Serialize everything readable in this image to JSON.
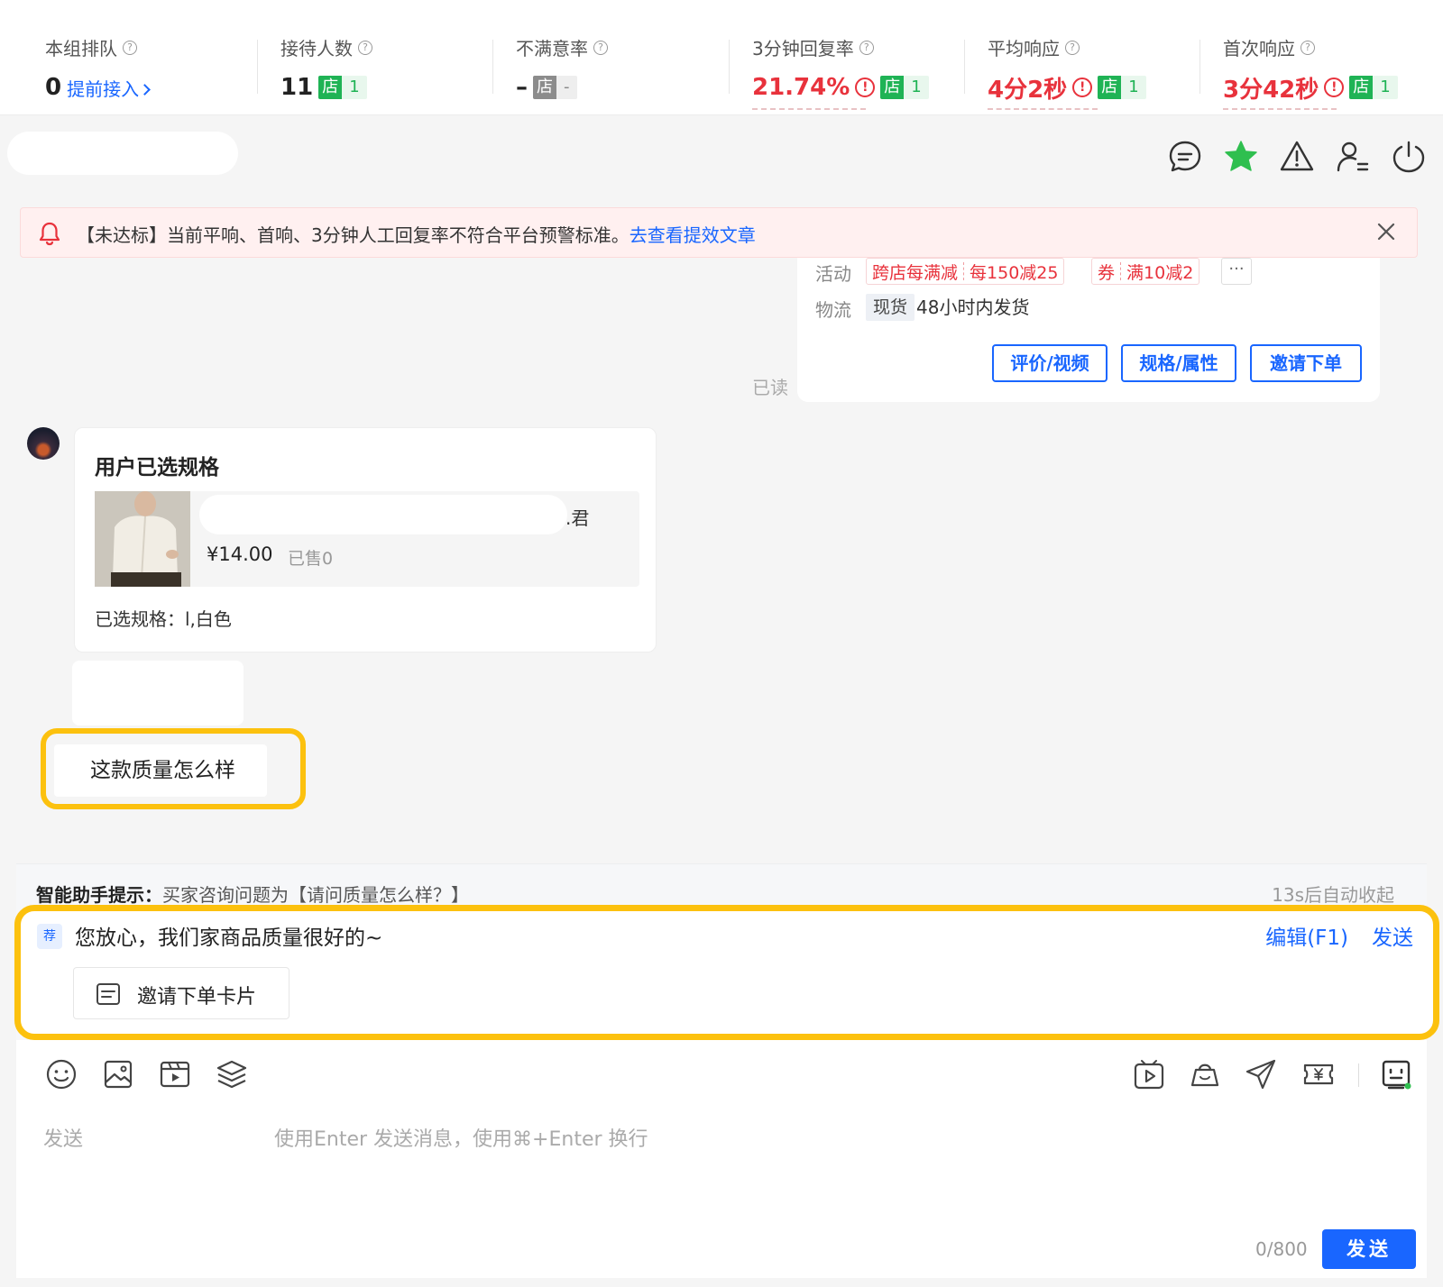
{
  "stats": [
    {
      "title": "本组排队",
      "value": "0",
      "link": "提前接入"
    },
    {
      "title": "接待人数",
      "value": "11",
      "shop_label": "店",
      "shop_count": "1"
    },
    {
      "title": "不满意率",
      "value": "–",
      "shop_label": "店",
      "shop_count": "-"
    },
    {
      "title": "3分钟回复率",
      "value": "21.74%",
      "shop_label": "店",
      "shop_count": "1"
    },
    {
      "title": "平均响应",
      "value": "4分2秒",
      "shop_label": "店",
      "shop_count": "1"
    },
    {
      "title": "首次响应",
      "value": "3分42秒",
      "shop_label": "店",
      "shop_count": "1"
    }
  ],
  "help_glyph": "?",
  "alert_glyph": "!",
  "header_icons": [
    "chat-bubble-icon",
    "star-icon",
    "warning-icon",
    "user-transfer-icon",
    "power-icon"
  ],
  "banner": {
    "text": "【未达标】当前平响、首响、3分钟人工回复率不符合平台预警标准。",
    "link": "去查看提效文章"
  },
  "product_card": {
    "activity_label": "活动",
    "promo1_a": "跨店每满减",
    "promo1_b": "每150减25",
    "promo2_a": "券",
    "promo2_b": "满10减2",
    "more": "···",
    "logistics_label": "物流",
    "stock_tag": "现货",
    "ship_text": "48小时内发货",
    "buttons": [
      "评价/视频",
      "规格/属性",
      "邀请下单"
    ]
  },
  "read_status": "已读",
  "spec_message": {
    "title": "用户已选规格",
    "name_tail": ".君",
    "price": "¥14.00",
    "sold": "已售0",
    "selected": "已选规格：l,白色"
  },
  "question": "这款质量怎么样",
  "assistant": {
    "label": "智能助手提示：",
    "hint": "买家咨询问题为【请问质量怎么样？】",
    "collapse": "13s后自动收起",
    "badge": "荐",
    "reply": "您放心，我们家商品质量很好的~",
    "edit": "编辑(F1)",
    "send": "发送",
    "invite_card": "邀请下单卡片"
  },
  "toolbar_icons": [
    "emoji-icon",
    "image-icon",
    "video-icon",
    "layers-icon",
    "video-play-icon",
    "shopping-bag-icon",
    "send-plane-icon",
    "coupon-icon",
    "robot-icon"
  ],
  "input": {
    "label": "发送",
    "placeholder": "使用Enter 发送消息，使用⌘+Enter 换行",
    "counter": "0/800",
    "send_button": "发送"
  },
  "colors": {
    "accent": "#1966ff",
    "alert_red": "#e8323c",
    "shop_green": "#1fb355",
    "highlight_yellow": "#fcc10e"
  }
}
